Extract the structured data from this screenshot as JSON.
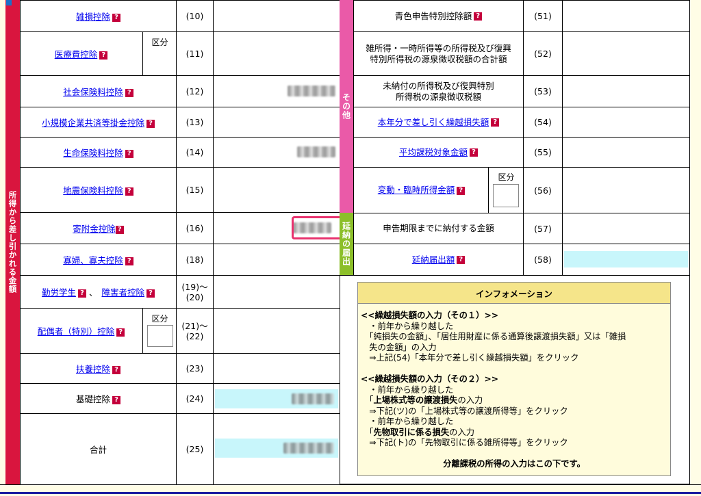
{
  "colors": {
    "left_band": "#d9153e",
    "sonota_band": "#ea5aa8",
    "ennou_band": "#8cbf2a",
    "highlight": "#e8326e",
    "cyan": "#c8f6fb",
    "info_header": "#f5e58a"
  },
  "left_band_label": "所得から差し引かれる金額",
  "sonota_label": "その他",
  "ennou_label": "延納の届出",
  "kubun_label": "区分",
  "left_rows": [
    {
      "label": "雑損控除",
      "num": "(10)"
    },
    {
      "label": "医療費控除",
      "num": "(11)"
    },
    {
      "label": "社会保険料控除",
      "num": "(12)"
    },
    {
      "label": "小規模企業共済等掛金控除",
      "num": "(13)"
    },
    {
      "label": "生命保険料控除",
      "num": "(14)"
    },
    {
      "label": "地震保険料控除",
      "num": "(15)"
    },
    {
      "label": "寄附金控除",
      "num": "(16)"
    },
    {
      "label": "寡婦、寡夫控除",
      "num": "(18)"
    },
    {
      "label": "勤労学生",
      "label2": "障害者控除",
      "sep": "、",
      "num": "(19)〜\n(20)"
    },
    {
      "label": "配偶者（特別）控除",
      "num": "(21)〜\n(22)"
    },
    {
      "label": "扶養控除",
      "num": "(23)"
    },
    {
      "label": "基礎控除",
      "num": "(24)"
    },
    {
      "label": "合計",
      "num": "(25)"
    }
  ],
  "right_rows": [
    {
      "label": "青色申告特別控除額",
      "num": "(51)"
    },
    {
      "label": "雑所得・一時所得等の所得税及び復興\n特別所得税の源泉徴収税額の合計額",
      "num": "(52)"
    },
    {
      "label": "未納付の所得税及び復興特別\n所得税の源泉徴収税額",
      "num": "(53)"
    },
    {
      "label": "本年分で差し引く繰越損失額",
      "num": "(54)"
    },
    {
      "label": "平均課税対象金額",
      "num": "(55)"
    },
    {
      "label": "変動・臨時所得金額",
      "num": "(56)"
    },
    {
      "label": "申告期限までに納付する金額",
      "num": "(57)"
    },
    {
      "label": "延納届出額",
      "num": "(58)"
    }
  ],
  "info": {
    "title": "インフォメーション",
    "lines": [
      {
        "text": "<<繰越損失額の入力（その１）>>",
        "bold": true
      },
      {
        "text": "　・前年から繰り越した"
      },
      {
        "text": "　「純損失の金額」、「居住用財産に係る通算後譲渡損失額」又は「雑損"
      },
      {
        "text": "　失の金額」の入力"
      },
      {
        "text": "　⇒上記(54)「本年分で差し引く繰越損失額」をクリック"
      },
      {
        "text": ""
      },
      {
        "text": "<<繰越損失額の入力（その２）>>",
        "bold": true
      },
      {
        "text": "　・前年から繰り越した"
      },
      {
        "text": "　「上場株式等の譲渡損失」の入力"
      },
      {
        "text": "　⇒下記(ツ)の「上場株式等の譲渡所得等」をクリック"
      },
      {
        "text": "　・前年から繰り越した"
      },
      {
        "text": "　「先物取引に係る損失」の入力"
      },
      {
        "text": "　⇒下記(ト)の「先物取引に係る雑所得等」をクリック"
      },
      {
        "text": ""
      },
      {
        "text": "分離課税の所得の入力はこの下です。",
        "bold": true,
        "center": true
      }
    ]
  },
  "help_icon": "question-icon"
}
